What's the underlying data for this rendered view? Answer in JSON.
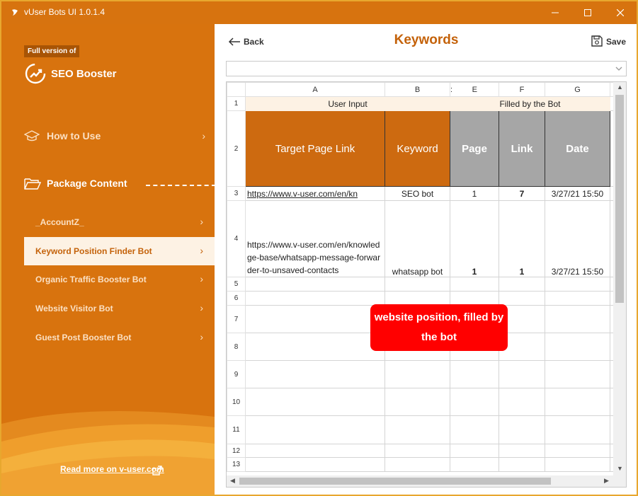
{
  "window": {
    "title": "vUser Bots UI 1.0.1.4"
  },
  "sidebar": {
    "badge": "Full version of",
    "brand": "SEO Booster",
    "how_to_use": "How to Use",
    "package_content": "Package Content",
    "items": [
      {
        "label": "_AccountZ_",
        "active": false
      },
      {
        "label": "Keyword Position Finder Bot",
        "active": true
      },
      {
        "label": "Organic Traffic Booster Bot",
        "active": false
      },
      {
        "label": "Website Visitor Bot",
        "active": false
      },
      {
        "label": "Guest Post Booster Bot",
        "active": false
      }
    ],
    "read_more": "Read more on v-user.com"
  },
  "header": {
    "back_label": "Back",
    "title": "Keywords",
    "save_label": "Save"
  },
  "sheet": {
    "columns": [
      "A",
      "B",
      ":",
      "E",
      "F",
      "G"
    ],
    "rows": [
      "1",
      "2",
      "3",
      "4",
      "5",
      "6",
      "7",
      "8",
      "9",
      "10",
      "11",
      "12",
      "13"
    ],
    "group_user": "User Input",
    "group_bot": "Filled by the Bot",
    "headers": {
      "target": "Target Page Link",
      "keyword": "Keyword",
      "page": "Page",
      "link": "Link",
      "date": "Date"
    },
    "data": [
      {
        "target": "https://www.v-user.com/en/kn",
        "keyword": "SEO bot",
        "page": "1",
        "link": "7",
        "date": "3/27/21 15:50"
      },
      {
        "target": "https://www.v-user.com/en/knowledge-base/whatsapp-message-forwarder-to-unsaved-contacts",
        "keyword": "whatsapp bot",
        "page": "1",
        "link": "1",
        "date": "3/27/21 15:50"
      }
    ]
  },
  "callout": "website position, filled by the bot",
  "colors": {
    "accent": "#d8730e",
    "title_color": "#c4620a",
    "callout": "#ff0000"
  }
}
